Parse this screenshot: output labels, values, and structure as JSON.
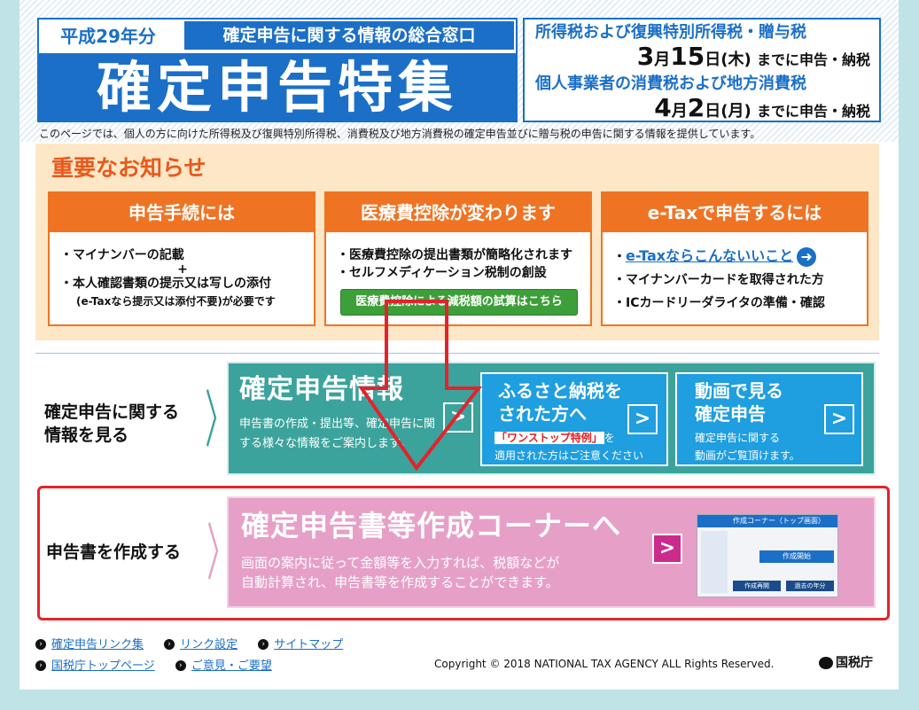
{
  "header": {
    "year": "平成29年分",
    "window_title": "確定申告に関する情報の総合窓口",
    "main_title": "確定申告特集",
    "deadline1_label": "所得税および復興特別所得税・贈与税",
    "deadline1_month": "3",
    "deadline1_day": "15",
    "deadline1_weekday": "日(木)",
    "deadline1_suffix": "までに申告・納税",
    "deadline2_label": "個人事業者の消費税および地方消費税",
    "deadline2_month": "4",
    "deadline2_day": "2",
    "deadline2_weekday": "日(月)",
    "deadline2_suffix": "までに申告・納税",
    "month_char": "月",
    "intro": "このページでは、個人の方に向けた所得税及び復興特別所得税、消費税及び地方消費税の確定申告並びに贈与税の申告に関する情報を提供しています。"
  },
  "notice": {
    "title": "重要なお知らせ",
    "cards": [
      {
        "header": "申告手続には",
        "line1": "・マイナンバーの記載",
        "plus": "+",
        "line2": "・本人確認書類の提示又は写しの添付",
        "line3": "(e-Taxなら提示又は添付不要)が必要です"
      },
      {
        "header": "医療費控除が変わります",
        "line1": "・医療費控除の提出書類が簡略化されます",
        "line2": "・セルフメディケーション税制の創設",
        "button": "医療費控除による減税額の試算はこちら"
      },
      {
        "header": "e-Taxで申告するには",
        "link": "e-Taxならこんないいこと",
        "line1": "・マイナンバーカードを取得された方",
        "line2": "・ICカードリーダライタの準備・確認"
      }
    ]
  },
  "info_row": {
    "label_line1": "確定申告に関する",
    "label_line2": "情報を見る",
    "main_title": "確定申告情報",
    "main_sub": "申告書の作成・提出等、確定申告に関する様々な情報をご案内します。",
    "furusato_title1": "ふるさと納税を",
    "furusato_title2": "された方へ",
    "furusato_red": "「ワンストップ特例」",
    "furusato_sub1": "を",
    "furusato_sub2": "適用された方はご注意ください",
    "video_title1": "動画で見る",
    "video_title2": "確定申告",
    "video_sub1": "確定申告に関する",
    "video_sub2": "動画がご覧頂けます。",
    "arrow": ">"
  },
  "create_row": {
    "label": "申告書を作成する",
    "title": "確定申告書等作成コーナーへ",
    "sub1": "画面の案内に従って金額等を入力すれば、税額などが",
    "sub2": "自動計算され、申告書等を作成することができます。",
    "arrow": ">",
    "thumb_bar": "作成コーナー（トップ画面）",
    "thumb_btn1": "作成開始",
    "thumb_btn2": "作成再開",
    "thumb_btn3": "過去の年分"
  },
  "footer": {
    "links_row1": [
      "確定申告リンク集",
      "リンク設定",
      "サイトマップ"
    ],
    "links_row2": [
      "国税庁トップページ",
      "ご意見・ご要望"
    ],
    "copyright": "Copyright © 2018 NATIONAL TAX AGENCY ALL Rights Reserved.",
    "agency": "国税庁"
  },
  "colors": {
    "brand_blue": "#1b6fc7",
    "notice_orange": "#ee7424",
    "info_teal": "#3ba39c",
    "create_pink": "#e6a0c8",
    "highlight_red": "#e3232b"
  }
}
